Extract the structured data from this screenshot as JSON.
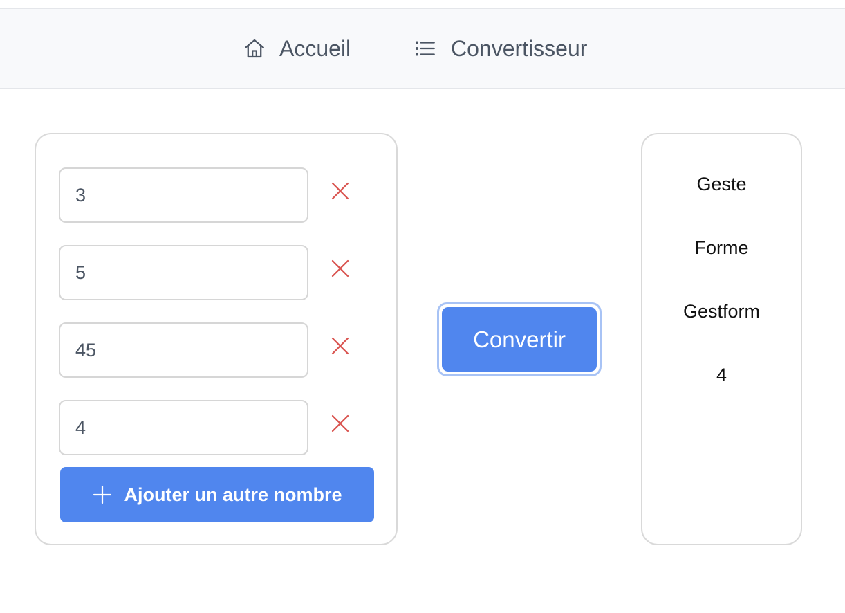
{
  "nav": {
    "items": [
      {
        "label": "Accueil",
        "icon": "home-icon"
      },
      {
        "label": "Convertisseur",
        "icon": "list-icon"
      }
    ]
  },
  "inputs": {
    "values": [
      "3",
      "5",
      "45",
      "4"
    ],
    "remove_icon": "close-icon",
    "remove_color": "#d9534f",
    "add_button_label": "Ajouter un autre nombre",
    "add_button_icon": "plus-icon"
  },
  "convert_button_label": "Convertir",
  "results": [
    "Geste",
    "Forme",
    "Gestform",
    "4"
  ],
  "colors": {
    "accent": "#5086ee",
    "accent_focus_ring": "#a8c3f5",
    "nav_bg": "#f8f9fb",
    "nav_text": "#4b5563"
  }
}
